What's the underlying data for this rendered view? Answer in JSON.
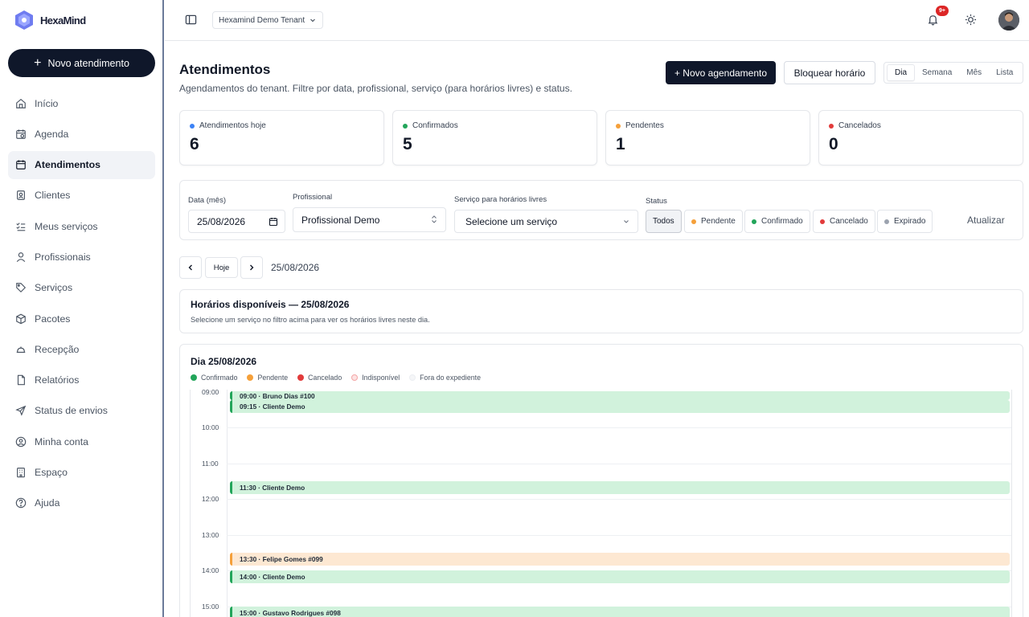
{
  "brand": {
    "name": "HexaMind"
  },
  "sidebar": {
    "new_button": "Novo atendimento",
    "items": [
      {
        "label": "Início",
        "icon": "home-icon"
      },
      {
        "label": "Agenda",
        "icon": "calendar-icon"
      },
      {
        "label": "Atendimentos",
        "icon": "calendar-check-icon",
        "active": true
      },
      {
        "label": "Clientes",
        "icon": "contact-icon"
      },
      {
        "label": "Meus serviços",
        "icon": "list-check-icon"
      },
      {
        "label": "Profissionais",
        "icon": "user-icon"
      },
      {
        "label": "Serviços",
        "icon": "tag-icon"
      },
      {
        "label": "Pacotes",
        "icon": "package-icon"
      },
      {
        "label": "Recepção",
        "icon": "bell-desk-icon"
      },
      {
        "label": "Relatórios",
        "icon": "file-icon"
      },
      {
        "label": "Status de envios",
        "icon": "send-icon"
      },
      {
        "label": "Minha conta",
        "icon": "user-circle-icon"
      },
      {
        "label": "Espaço",
        "icon": "building-icon"
      },
      {
        "label": "Ajuda",
        "icon": "help-icon"
      }
    ]
  },
  "topbar": {
    "tenant": "Hexamind Demo Tenant",
    "notifications_badge": "9+"
  },
  "header": {
    "title": "Atendimentos",
    "subtitle": "Agendamentos do tenant. Filtre por data, profissional, serviço (para horários livres) e status.",
    "new_booking": "+ Novo agendamento",
    "block_time": "Bloquear horário",
    "views": [
      "Dia",
      "Semana",
      "Mês",
      "Lista"
    ],
    "active_view": "Dia"
  },
  "stats": [
    {
      "label": "Atendimentos hoje",
      "value": "6",
      "color": "#3b82f6"
    },
    {
      "label": "Confirmados",
      "value": "5",
      "color": "#22a55a"
    },
    {
      "label": "Pendentes",
      "value": "1",
      "color": "#f5a03a"
    },
    {
      "label": "Cancelados",
      "value": "0",
      "color": "#e23b3b"
    }
  ],
  "filters": {
    "date_label": "Data (mês)",
    "date_value": "25/08/2026",
    "professional_label": "Profissional",
    "professional_value": "Profissional Demo",
    "service_label": "Serviço para horários livres",
    "service_value": "Selecione um serviço",
    "status_label": "Status",
    "status_chips": [
      {
        "label": "Todos",
        "active": true
      },
      {
        "label": "Pendente",
        "color": "#f5a03a"
      },
      {
        "label": "Confirmado",
        "color": "#22a55a"
      },
      {
        "label": "Cancelado",
        "color": "#e23b3b"
      },
      {
        "label": "Expirado",
        "color": "#9ca3af"
      }
    ],
    "refresh": "Atualizar"
  },
  "date_nav": {
    "today": "Hoje",
    "current": "25/08/2026"
  },
  "available": {
    "title": "Horários disponíveis — 25/08/2026",
    "subtitle": "Selecione um serviço no filtro acima para ver os horários livres neste dia."
  },
  "day_panel": {
    "title": "Dia 25/08/2026",
    "legend": [
      {
        "label": "Confirmado",
        "color": "#22a55a"
      },
      {
        "label": "Pendente",
        "color": "#f5a03a"
      },
      {
        "label": "Cancelado",
        "color": "#e23b3b"
      },
      {
        "label": "Indisponível",
        "color": "#fca5a5"
      },
      {
        "label": "Fora do expediente",
        "color": "#f3f4f6"
      }
    ],
    "hours": [
      "09:00",
      "10:00",
      "11:00",
      "12:00",
      "13:00",
      "14:00",
      "15:00"
    ],
    "events": [
      {
        "time": "09:00",
        "label": "09:00 · Bruno Dias #100",
        "status": "confirmed"
      },
      {
        "time": "09:15",
        "label": "09:15 · Cliente Demo",
        "status": "confirmed"
      },
      {
        "time": "11:30",
        "label": "11:30 · Cliente Demo",
        "status": "confirmed"
      },
      {
        "time": "13:30",
        "label": "13:30 · Felipe Gomes #099",
        "status": "pending"
      },
      {
        "time": "14:00",
        "label": "14:00 · Cliente Demo",
        "status": "confirmed"
      },
      {
        "time": "15:00",
        "label": "15:00 · Gustavo Rodrigues #098",
        "status": "confirmed"
      }
    ]
  }
}
